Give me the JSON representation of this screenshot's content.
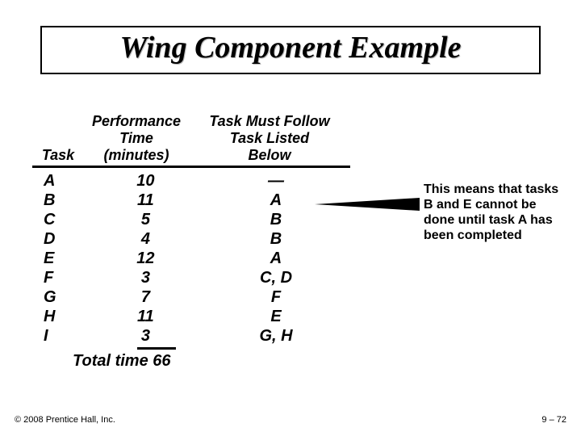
{
  "title": "Wing Component Example",
  "table": {
    "headers": {
      "task_h1": "",
      "task_h2": "",
      "task_h3": "Task",
      "time_h1": "Performance",
      "time_h2": "Time",
      "time_h3": "(minutes)",
      "dep_h1": "Task Must Follow",
      "dep_h2": "Task Listed",
      "dep_h3": "Below"
    },
    "rows": [
      {
        "task": "A",
        "time": "10",
        "dep": "—"
      },
      {
        "task": "B",
        "time": "11",
        "dep": "A"
      },
      {
        "task": "C",
        "time": "5",
        "dep": "B"
      },
      {
        "task": "D",
        "time": "4",
        "dep": "B"
      },
      {
        "task": "E",
        "time": "12",
        "dep": "A"
      },
      {
        "task": "F",
        "time": "3",
        "dep": "C, D"
      },
      {
        "task": "G",
        "time": "7",
        "dep": "F"
      },
      {
        "task": "H",
        "time": "11",
        "dep": "E"
      },
      {
        "task": "I",
        "time": "3",
        "dep": "G, H"
      }
    ],
    "total_label": "Total time",
    "total_value": "66"
  },
  "annotation": "This means that tasks B and E cannot be done until task A has been completed",
  "copyright": "© 2008 Prentice Hall, Inc.",
  "page_number": "9 – 72"
}
